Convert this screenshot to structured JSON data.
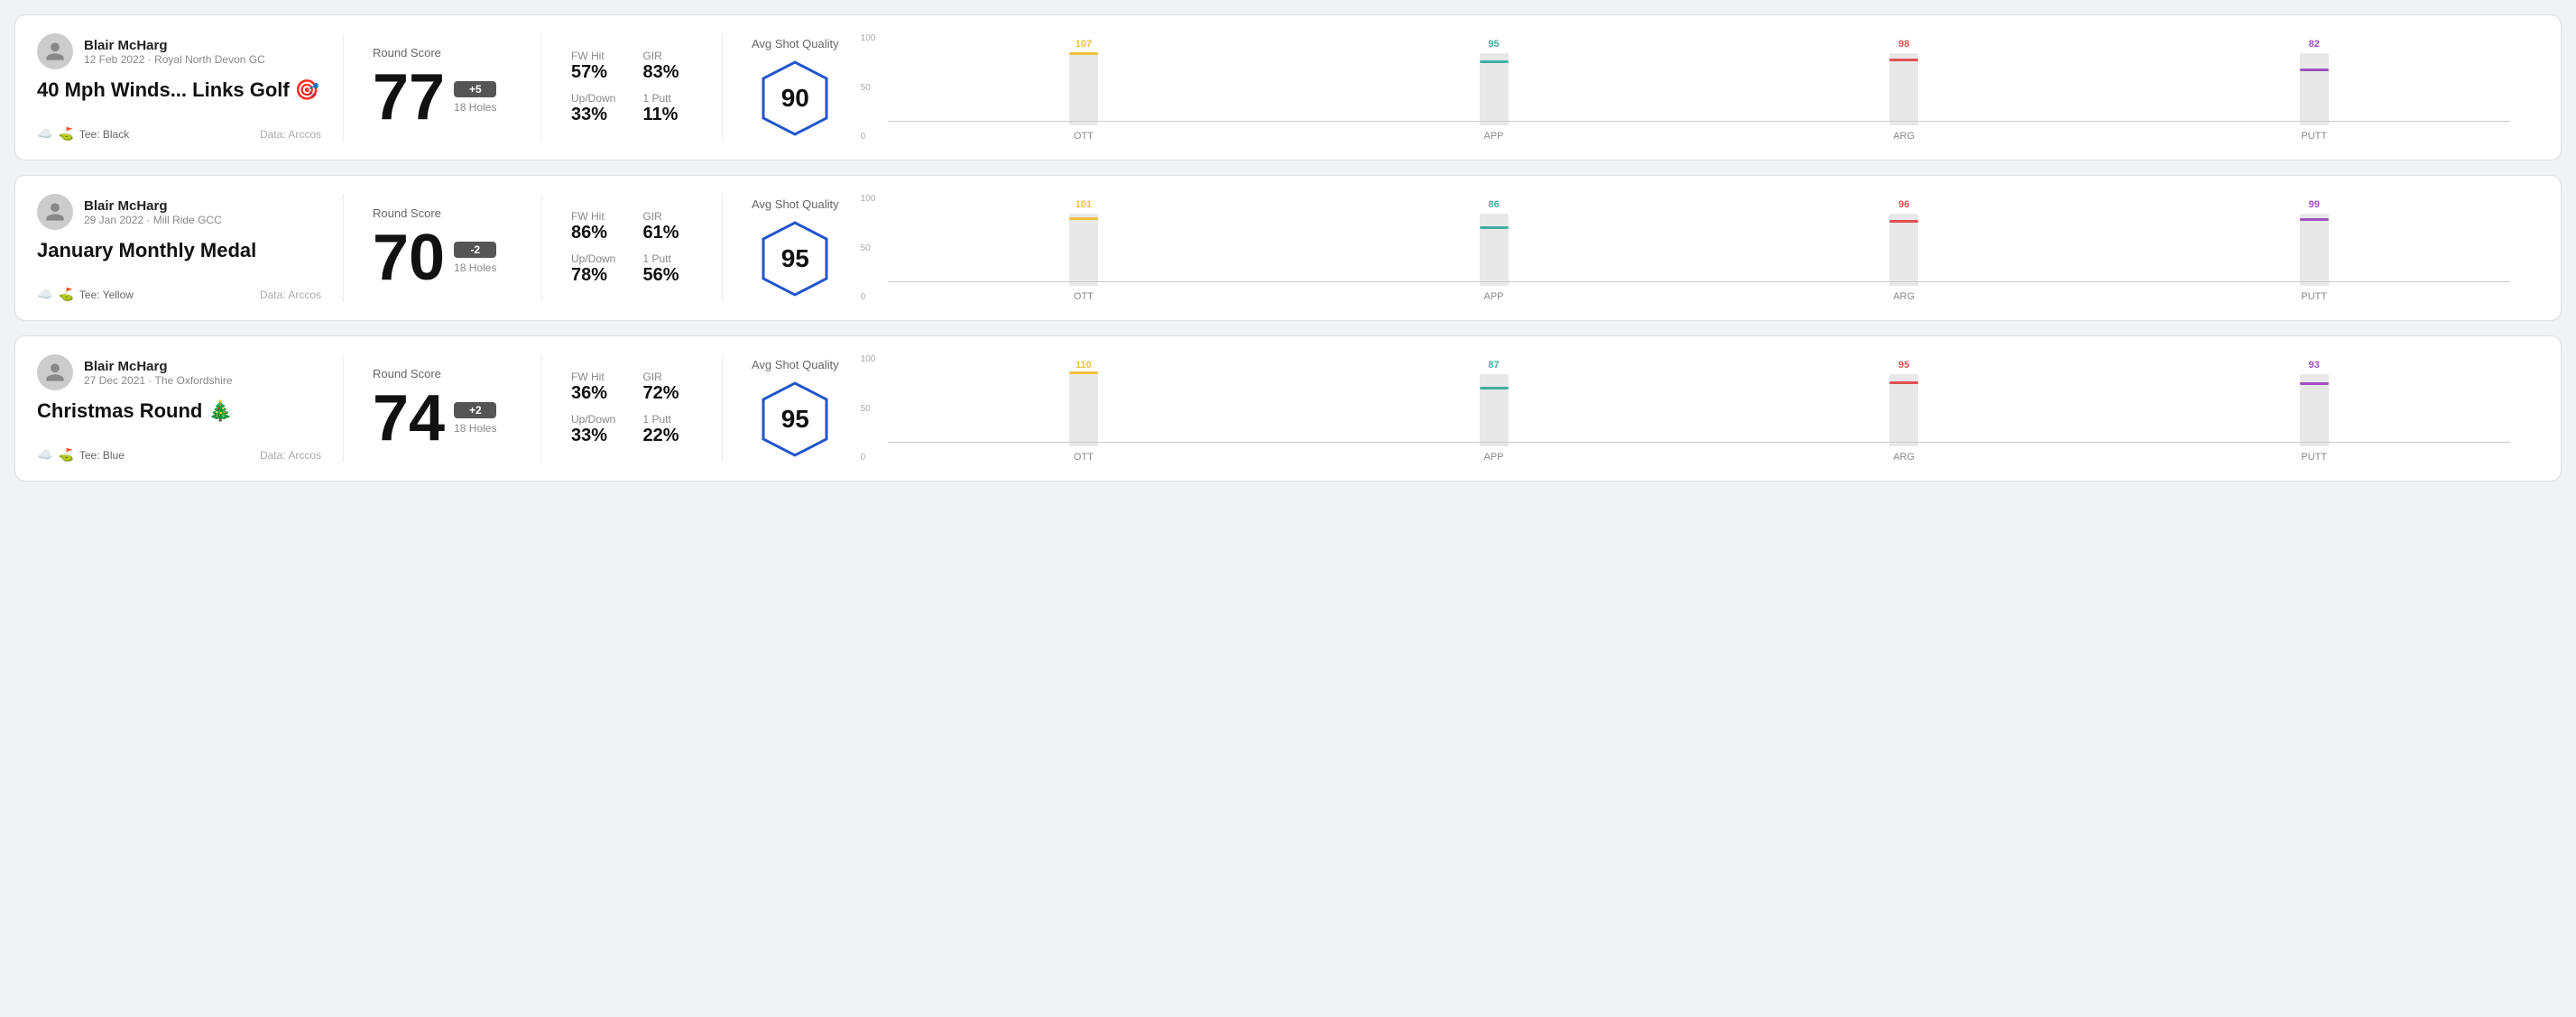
{
  "rounds": [
    {
      "id": "round1",
      "user": "Blair McHarg",
      "date": "12 Feb 2022 · Royal North Devon GC",
      "title": "40 Mph Winds... Links Golf 🎯",
      "tee": "Black",
      "dataSource": "Data: Arccos",
      "score": 77,
      "scoreDiff": "+5",
      "holes": "18 Holes",
      "fwHit": "57%",
      "gir": "83%",
      "upDown": "33%",
      "onePutt": "11%",
      "avgShotQuality": 90,
      "bars": [
        {
          "label": "OTT",
          "value": 107,
          "color": "#f0c040",
          "fillPct": 75
        },
        {
          "label": "APP",
          "value": 95,
          "color": "#40b0a0",
          "fillPct": 60
        },
        {
          "label": "ARG",
          "value": 98,
          "color": "#e05050",
          "fillPct": 65
        },
        {
          "label": "PUTT",
          "value": 82,
          "color": "#a050c0",
          "fillPct": 50
        }
      ]
    },
    {
      "id": "round2",
      "user": "Blair McHarg",
      "date": "29 Jan 2022 · Mill Ride GCC",
      "title": "January Monthly Medal",
      "tee": "Yellow",
      "dataSource": "Data: Arccos",
      "score": 70,
      "scoreDiff": "-2",
      "holes": "18 Holes",
      "fwHit": "86%",
      "gir": "61%",
      "upDown": "78%",
      "onePutt": "56%",
      "avgShotQuality": 95,
      "bars": [
        {
          "label": "OTT",
          "value": 101,
          "color": "#f0c040",
          "fillPct": 72
        },
        {
          "label": "APP",
          "value": 86,
          "color": "#40b0a0",
          "fillPct": 55
        },
        {
          "label": "ARG",
          "value": 96,
          "color": "#e05050",
          "fillPct": 65
        },
        {
          "label": "PUTT",
          "value": 99,
          "color": "#a050c0",
          "fillPct": 68
        }
      ]
    },
    {
      "id": "round3",
      "user": "Blair McHarg",
      "date": "27 Dec 2021 · The Oxfordshire",
      "title": "Christmas Round 🎄",
      "tee": "Blue",
      "dataSource": "Data: Arccos",
      "score": 74,
      "scoreDiff": "+2",
      "holes": "18 Holes",
      "fwHit": "36%",
      "gir": "72%",
      "upDown": "33%",
      "onePutt": "22%",
      "avgShotQuality": 95,
      "bars": [
        {
          "label": "OTT",
          "value": 110,
          "color": "#f0c040",
          "fillPct": 78
        },
        {
          "label": "APP",
          "value": 87,
          "color": "#40b0a0",
          "fillPct": 56
        },
        {
          "label": "ARG",
          "value": 95,
          "color": "#e05050",
          "fillPct": 64
        },
        {
          "label": "PUTT",
          "value": 93,
          "color": "#a050c0",
          "fillPct": 63
        }
      ]
    }
  ],
  "labels": {
    "roundScore": "Round Score",
    "fwHit": "FW Hit",
    "gir": "GIR",
    "upDown": "Up/Down",
    "onePutt": "1 Putt",
    "avgShotQuality": "Avg Shot Quality"
  }
}
